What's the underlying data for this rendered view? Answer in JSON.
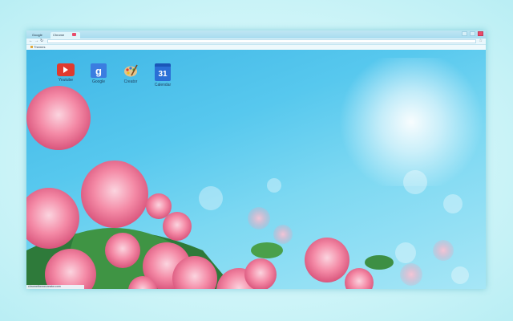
{
  "browser": {
    "tabs": [
      {
        "label": "Google",
        "active": false
      },
      {
        "label": "Chrome",
        "active": true
      }
    ],
    "bookmarks": [
      {
        "label": "Themes"
      }
    ],
    "status_text": "chromethemecreator.com"
  },
  "apps": [
    {
      "label": "Youtube",
      "icon": "youtube-icon"
    },
    {
      "label": "Google",
      "icon": "google-icon",
      "glyph": "g"
    },
    {
      "label": "Creator",
      "icon": "palette-icon"
    },
    {
      "label": "Calendar",
      "icon": "calendar-icon",
      "glyph": "31"
    }
  ],
  "colors": {
    "accent": "#e84b6a",
    "sky": "#4fc0ec",
    "rose": "#f58aa8"
  }
}
